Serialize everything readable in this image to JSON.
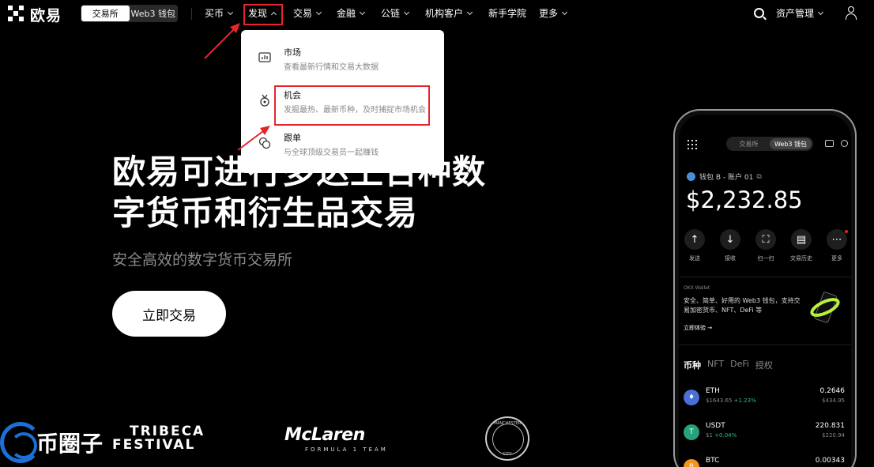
{
  "brand": {
    "name": "欧易"
  },
  "mode_switch": {
    "exchange": "交易所",
    "web3": "Web3 钱包"
  },
  "nav": {
    "buy": "买币",
    "discover": "发现",
    "trade": "交易",
    "finance": "金融",
    "chain": "公链",
    "institution": "机构客户",
    "academy": "新手学院",
    "more": "更多",
    "assets": "资产管理"
  },
  "dropdown": {
    "items": [
      {
        "title": "市场",
        "desc": "查看最新行情和交易大数据",
        "icon": "chart-icon"
      },
      {
        "title": "机会",
        "desc": "发掘最热、最新币种，及时捕捉市场机会",
        "icon": "medal-icon"
      },
      {
        "title": "跟单",
        "desc": "与全球顶级交易员一起赚钱",
        "icon": "copy-trade-icon"
      }
    ]
  },
  "hero": {
    "title_line1": "欧易可进行多达上百种数",
    "title_line2": "字货币和衍生品交易",
    "subtitle": "安全高效的数字货币交易所",
    "cta": "立即交易"
  },
  "partners": {
    "watermark": "币圈子",
    "tribeca_line1": "TRIBECA",
    "tribeca_line2": "FESTIVAL",
    "mclaren": "McLaren",
    "mclaren_sub": "FORMULA 1 TEAM",
    "mancity_top": "MANCHESTER",
    "mancity_bottom": "CITY"
  },
  "phone": {
    "seg_exchange": "交易所",
    "seg_web3": "Web3 钱包",
    "wallet_label": "钱包 B - 账户 01",
    "balance": "$2,232.85",
    "actions": [
      "发送",
      "接收",
      "扫一扫",
      "交易历史",
      "更多"
    ],
    "promo": {
      "label": "OKX Wallet",
      "text": "安全、简单、好用的 Web3 钱包，支持交易加密货币、NFT、DeFi 等",
      "link": "立即体验 →"
    },
    "tabs": [
      "币种",
      "NFT",
      "DeFi",
      "授权"
    ],
    "coins": [
      {
        "name": "ETH",
        "price": "$1643.65",
        "change": "+1.23%",
        "amount": "0.2646",
        "value": "$434.95",
        "color": "#4a6fd6"
      },
      {
        "name": "USDT",
        "price": "$1",
        "change": "+0.04%",
        "amount": "220.831",
        "value": "$220.94",
        "color": "#26a17b"
      },
      {
        "name": "BTC",
        "price": "",
        "change": "",
        "amount": "0.00343",
        "value": "",
        "color": "#f7931a"
      }
    ]
  },
  "colors": {
    "accent_red": "#e5242b",
    "positive": "#2ebd85"
  }
}
